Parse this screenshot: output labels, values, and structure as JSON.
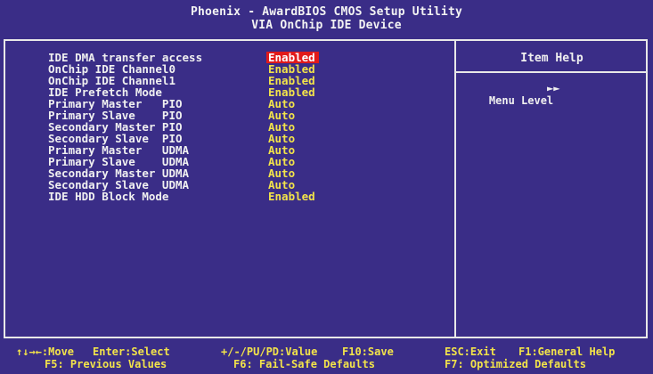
{
  "header": {
    "title": "Phoenix - AwardBIOS CMOS Setup Utility",
    "subtitle": "VIA OnChip IDE Device"
  },
  "settings": [
    {
      "label": "IDE DMA transfer access",
      "value": "Enabled",
      "selected": true
    },
    {
      "label": "OnChip IDE Channel0",
      "value": "Enabled",
      "selected": false
    },
    {
      "label": "OnChip IDE Channel1",
      "value": "Enabled",
      "selected": false
    },
    {
      "label": "IDE Prefetch Mode",
      "value": "Enabled",
      "selected": false
    },
    {
      "label": "Primary Master   PIO",
      "value": "Auto",
      "selected": false
    },
    {
      "label": "Primary Slave    PIO",
      "value": "Auto",
      "selected": false
    },
    {
      "label": "Secondary Master PIO",
      "value": "Auto",
      "selected": false
    },
    {
      "label": "Secondary Slave  PIO",
      "value": "Auto",
      "selected": false
    },
    {
      "label": "Primary Master   UDMA",
      "value": "Auto",
      "selected": false
    },
    {
      "label": "Primary Slave    UDMA",
      "value": "Auto",
      "selected": false
    },
    {
      "label": "Secondary Master UDMA",
      "value": "Auto",
      "selected": false
    },
    {
      "label": "Secondary Slave  UDMA",
      "value": "Auto",
      "selected": false
    },
    {
      "label": "IDE HDD Block Mode",
      "value": "Enabled",
      "selected": false
    }
  ],
  "help": {
    "title": "Item Help",
    "menu_level_label": "Menu Level",
    "menu_level_arrow": "►►"
  },
  "footer": {
    "row1": [
      {
        "text": "↑↓→←:Move"
      },
      {
        "text": "Enter:Select"
      },
      {
        "text": "+/-/PU/PD:Value"
      },
      {
        "text": "F10:Save"
      },
      {
        "text": "ESC:Exit"
      },
      {
        "text": "F1:General Help"
      }
    ],
    "row2": [
      {
        "text": "F5: Previous Values"
      },
      {
        "text": "F6: Fail-Safe Defaults"
      },
      {
        "text": "F7: Optimized Defaults"
      }
    ]
  },
  "colors": {
    "background": "#3a2d87",
    "value_text": "#f2e34a",
    "selected_bg": "#e11a1a",
    "border": "#e8e8e8"
  }
}
